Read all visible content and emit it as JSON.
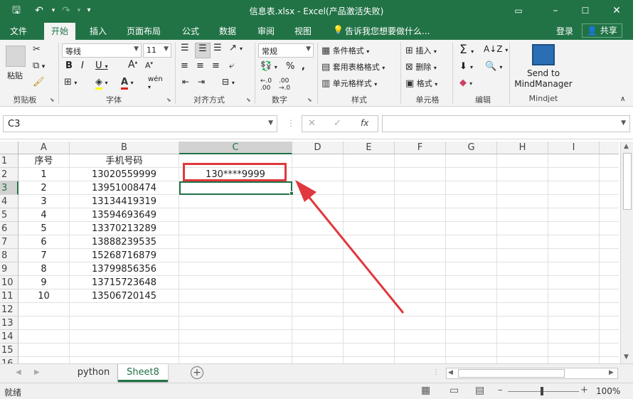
{
  "window": {
    "title": "信息表.xlsx - Excel(产品激活失败)"
  },
  "ribbon_tabs": [
    "文件",
    "开始",
    "插入",
    "页面布局",
    "公式",
    "数据",
    "审阅",
    "视图"
  ],
  "tell_me": "告诉我您想要做什么...",
  "login": "登录",
  "share": "共享",
  "clipboard": {
    "paste": "粘贴",
    "group": "剪贴板"
  },
  "font": {
    "name": "等线",
    "size": "11",
    "group": "字体"
  },
  "alignment": {
    "group": "对齐方式"
  },
  "number": {
    "format": "常规",
    "group": "数字"
  },
  "styles": {
    "conditional": "条件格式",
    "table": "套用表格格式",
    "cell": "单元格样式",
    "group": "样式"
  },
  "cells": {
    "insert": "插入",
    "delete": "删除",
    "format": "格式",
    "group": "单元格"
  },
  "editing": {
    "group": "编辑"
  },
  "mindjet": {
    "line1": "Send to",
    "line2": "MindManager",
    "group": "Mindjet"
  },
  "name_box": "C3",
  "fx": "fx",
  "columns": [
    "A",
    "B",
    "C",
    "D",
    "E",
    "F",
    "G",
    "H",
    "I"
  ],
  "rows": [
    "1",
    "2",
    "3",
    "4",
    "5",
    "6",
    "7",
    "8",
    "9",
    "10",
    "11",
    "12",
    "13",
    "14",
    "15",
    "16"
  ],
  "table": {
    "headers": [
      "序号",
      "手机号码"
    ],
    "data": [
      [
        "1",
        "13020559999"
      ],
      [
        "2",
        "13951008474"
      ],
      [
        "3",
        "13134419319"
      ],
      [
        "4",
        "13594693649"
      ],
      [
        "5",
        "13370213289"
      ],
      [
        "6",
        "13888239535"
      ],
      [
        "7",
        "15268716879"
      ],
      [
        "8",
        "13799856356"
      ],
      [
        "9",
        "13715723648"
      ],
      [
        "10",
        "13506720145"
      ]
    ]
  },
  "c2_value": "130****9999",
  "sheets": [
    "python",
    "Sheet8"
  ],
  "active_sheet": "Sheet8",
  "status": {
    "ready": "就绪",
    "zoom": "100%"
  },
  "colors": {
    "excel_green": "#217346",
    "annotation_red": "#e0383e"
  }
}
